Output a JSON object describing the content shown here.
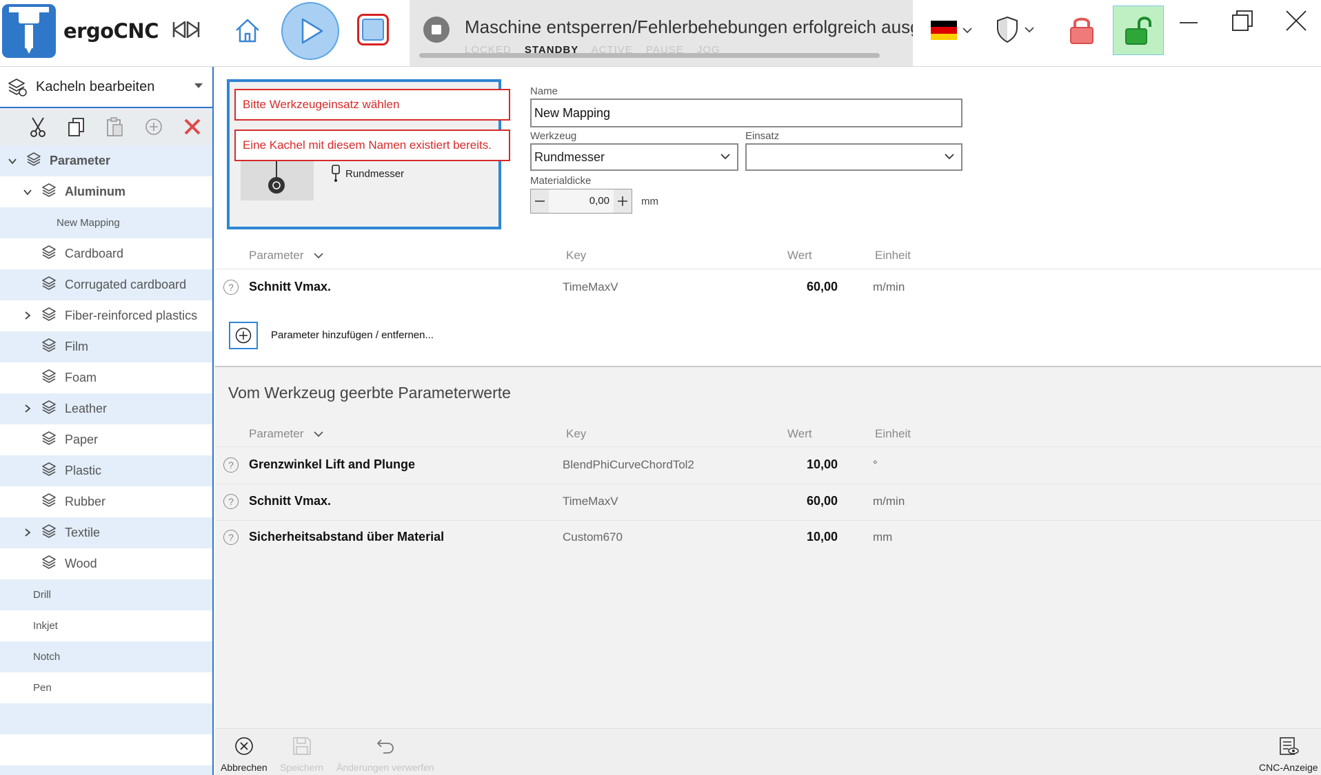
{
  "app": {
    "name": "ergoCNC"
  },
  "status": {
    "message": "Maschine entsperren/Fehlerbehebungen erfolgreich ausge",
    "states": [
      "LOCKED",
      "STANDBY",
      "ACTIVE",
      "PAUSE",
      "JOG"
    ],
    "active_state": "STANDBY"
  },
  "colors": {
    "accent": "#2f77c8",
    "error": "#d82a2a",
    "unlock_bg": "#bff0c4",
    "play_fill": "#a9d0f2"
  },
  "sidebar": {
    "mode_title": "Kacheln bearbeiten",
    "items": [
      {
        "label": "Parameter",
        "level": 0,
        "expander": "expanded",
        "icon": "layers-icon",
        "bold": true
      },
      {
        "label": "Aluminum",
        "level": 1,
        "expander": "expanded",
        "icon": "layers-icon",
        "bold": true
      },
      {
        "label": "New Mapping",
        "level": 2,
        "expander": "none",
        "icon": "none",
        "bold": false
      },
      {
        "label": "Cardboard",
        "level": 1,
        "expander": "none",
        "icon": "layers-icon",
        "bold": false
      },
      {
        "label": "Corrugated cardboard",
        "level": 1,
        "expander": "none",
        "icon": "layers-icon",
        "bold": false
      },
      {
        "label": "Fiber-reinforced plastics",
        "level": 1,
        "expander": "collapsed",
        "icon": "layers-icon",
        "bold": false
      },
      {
        "label": "Film",
        "level": 1,
        "expander": "none",
        "icon": "layers-icon",
        "bold": false
      },
      {
        "label": "Foam",
        "level": 1,
        "expander": "none",
        "icon": "layers-icon",
        "bold": false
      },
      {
        "label": "Leather",
        "level": 1,
        "expander": "collapsed",
        "icon": "layers-icon",
        "bold": false
      },
      {
        "label": "Paper",
        "level": 1,
        "expander": "none",
        "icon": "layers-icon",
        "bold": false
      },
      {
        "label": "Plastic",
        "level": 1,
        "expander": "none",
        "icon": "layers-icon",
        "bold": false
      },
      {
        "label": "Rubber",
        "level": 1,
        "expander": "none",
        "icon": "layers-icon",
        "bold": false
      },
      {
        "label": "Textile",
        "level": 1,
        "expander": "collapsed",
        "icon": "layers-icon",
        "bold": false
      },
      {
        "label": "Wood",
        "level": 1,
        "expander": "none",
        "icon": "layers-icon",
        "bold": false
      },
      {
        "label": "Drill",
        "level": 0,
        "expander": "none",
        "icon": "none",
        "bold": false
      },
      {
        "label": "Inkjet",
        "level": 0,
        "expander": "none",
        "icon": "none",
        "bold": false
      },
      {
        "label": "Notch",
        "level": 0,
        "expander": "none",
        "icon": "none",
        "bold": false
      },
      {
        "label": "Pen",
        "level": 0,
        "expander": "none",
        "icon": "none",
        "bold": false
      }
    ]
  },
  "tile": {
    "tool_label": "Rundmesser",
    "errors": [
      "Bitte Werkzeugeinsatz wählen",
      "Eine Kachel mit diesem Namen existiert bereits."
    ]
  },
  "form": {
    "name_label": "Name",
    "name_value": "New Mapping",
    "tool_label": "Werkzeug",
    "tool_value": "Rundmesser",
    "insert_label": "Einsatz",
    "insert_value": "",
    "thickness_label": "Materialdicke",
    "thickness_value": "0,00",
    "thickness_unit": "mm"
  },
  "columns": {
    "parameter": "Parameter",
    "key": "Key",
    "value": "Wert",
    "unit": "Einheit"
  },
  "parameters": [
    {
      "name": "Schnitt Vmax.",
      "key": "TimeMaxV",
      "value": "60,00",
      "unit": "m/min"
    }
  ],
  "add_param_label": "Parameter hinzufügen / entfernen...",
  "inherited": {
    "title": "Vom Werkzeug geerbte Parameterwerte",
    "rows": [
      {
        "name": "Grenzwinkel Lift and Plunge",
        "key": "BlendPhiCurveChordTol2",
        "value": "10,00",
        "unit": "°"
      },
      {
        "name": "Schnitt Vmax.",
        "key": "TimeMaxV",
        "value": "60,00",
        "unit": "m/min"
      },
      {
        "name": "Sicherheitsabstand über Material",
        "key": "Custom670",
        "value": "10,00",
        "unit": "mm"
      }
    ]
  },
  "bottom": {
    "cancel": "Abbrechen",
    "save": "Speichern",
    "revert": "Änderungen verwerfen",
    "cnc_view": "CNC-Anzeige"
  }
}
